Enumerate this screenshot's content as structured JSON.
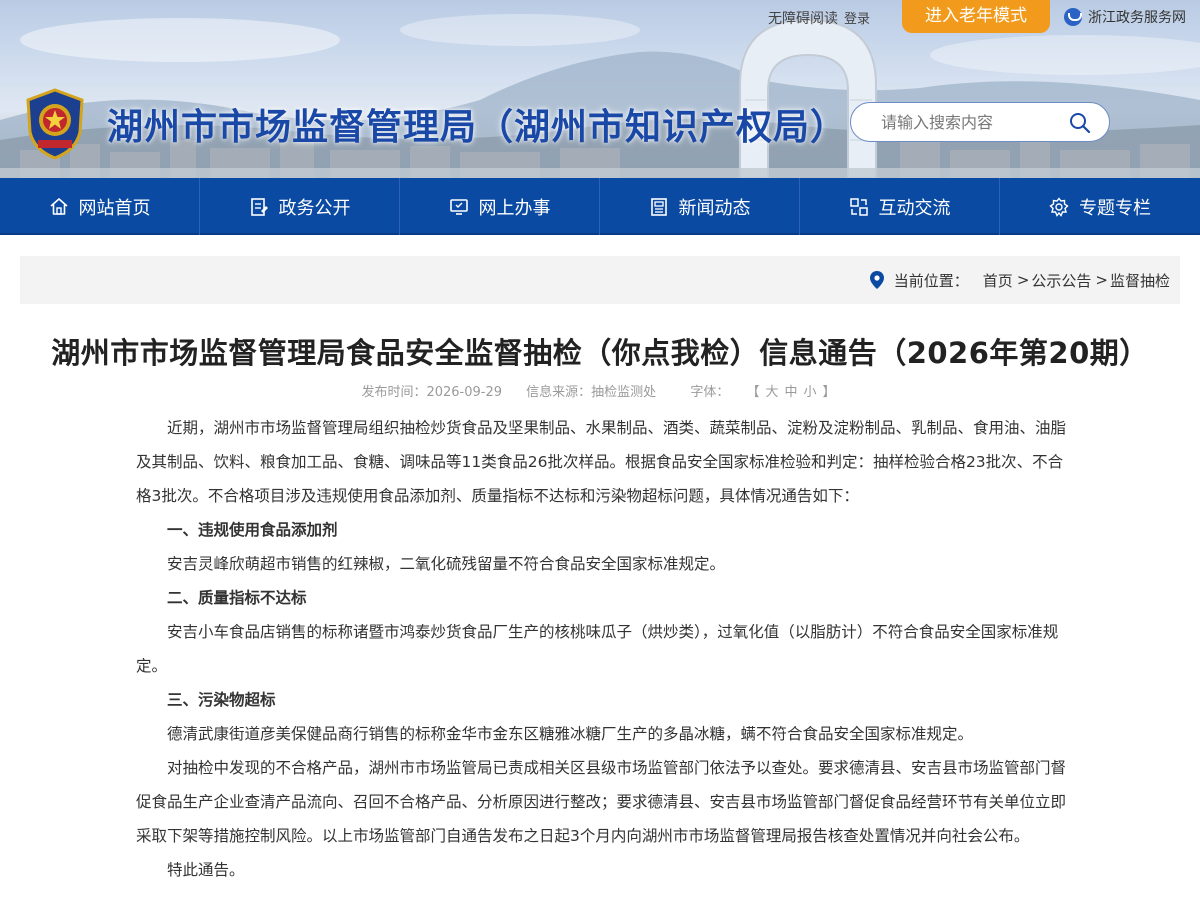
{
  "topbar": {
    "accessible_reading": "无障碍阅读",
    "login": "登录",
    "elder_mode": "进入老年模式",
    "zj_service": "浙江政务服务网"
  },
  "header": {
    "site_title": "湖州市市场监督管理局（湖州市知识产权局）",
    "search_placeholder": "请输入搜索内容"
  },
  "nav": {
    "items": [
      {
        "label": "网站首页",
        "icon": "home-icon"
      },
      {
        "label": "政务公开",
        "icon": "document-icon"
      },
      {
        "label": "网上办事",
        "icon": "monitor-icon"
      },
      {
        "label": "新闻动态",
        "icon": "news-icon"
      },
      {
        "label": "互动交流",
        "icon": "interaction-icon"
      },
      {
        "label": "专题专栏",
        "icon": "topic-icon"
      }
    ]
  },
  "breadcrumb": {
    "label": "当前位置：",
    "items": [
      "首页",
      "公示公告",
      "监督抽检"
    ],
    "separator": ">"
  },
  "article": {
    "title": "湖州市市场监督管理局食品安全监督抽检（你点我检）信息通告（2026年第20期）",
    "meta": {
      "publish_time": "发布时间：2026-09-29",
      "source": "信息来源：抽检监测处",
      "font_label": "字体：",
      "bracket_open": "【",
      "size_large": "大",
      "size_medium": "中",
      "size_small": "小",
      "bracket_close": "】"
    },
    "paragraphs": [
      "近期，湖州市市场监督管理局组织抽检炒货食品及坚果制品、水果制品、酒类、蔬菜制品、淀粉及淀粉制品、乳制品、食用油、油脂及其制品、饮料、粮食加工品、食糖、调味品等11类食品26批次样品。根据食品安全国家标准检验和判定：抽样检验合格23批次、不合格3批次。不合格项目涉及违规使用食品添加剂、质量指标不达标和污染物超标问题，具体情况通告如下：",
      "一、违规使用食品添加剂",
      "安吉灵峰欣萌超市销售的红辣椒，二氧化硫残留量不符合食品安全国家标准规定。",
      "二、质量指标不达标",
      "安吉小车食品店销售的标称诸暨市鸿泰炒货食品厂生产的核桃味瓜子（烘炒类），过氧化值（以脂肪计）不符合食品安全国家标准规定。",
      "三、污染物超标",
      "德清武康街道彦美保健品商行销售的标称金华市金东区糖雅冰糖厂生产的多晶冰糖，螨不符合食品安全国家标准规定。",
      "对抽检中发现的不合格产品，湖州市市场监管局已责成相关区县级市场监管部门依法予以查处。要求德清县、安吉县市场监管部门督促食品生产企业查清产品流向、召回不合格产品、分析原因进行整改；要求德清县、安吉县市场监管部门督促食品经营环节有关单位立即采取下架等措施控制风险。以上市场监管部门自通告发布之日起3个月内向湖州市市场监督管理局报告核查处置情况并向社会公布。",
      "特此通告。"
    ]
  },
  "colors": {
    "nav_blue": "#0b4aa2",
    "title_blue": "#1a48a7",
    "elder_orange": "#f29a1b"
  }
}
